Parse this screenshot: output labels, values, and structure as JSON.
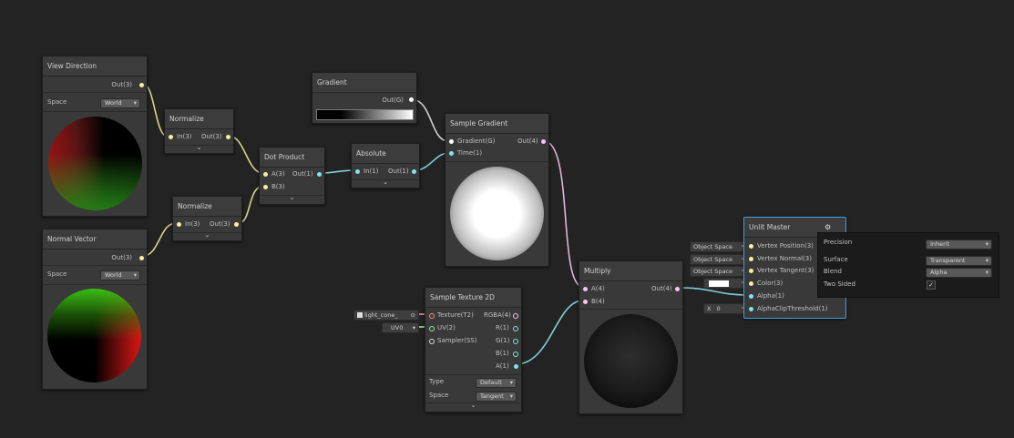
{
  "view_direction": {
    "title": "View Direction",
    "out": "Out(3)",
    "space_label": "Space",
    "space_value": "World"
  },
  "normal_vector": {
    "title": "Normal Vector",
    "out": "Out(3)",
    "space_label": "Space",
    "space_value": "World"
  },
  "normalize_1": {
    "title": "Normalize",
    "in": "In(3)",
    "out": "Out(3)"
  },
  "normalize_2": {
    "title": "Normalize",
    "in": "In(3)",
    "out": "Out(3)"
  },
  "dot_product": {
    "title": "Dot Product",
    "a": "A(3)",
    "b": "B(3)",
    "out": "Out(1)"
  },
  "gradient": {
    "title": "Gradient",
    "out": "Out(G)"
  },
  "absolute": {
    "title": "Absolute",
    "in": "In(1)",
    "out": "Out(1)"
  },
  "sample_gradient": {
    "title": "Sample Gradient",
    "gradient_in": "Gradient(G)",
    "time_in": "Time(1)",
    "out": "Out(4)"
  },
  "sample_texture": {
    "title": "Sample Texture 2D",
    "inputs": [
      "Texture(T2)",
      "UV(2)",
      "Sampler(SS)"
    ],
    "outputs": [
      "RGBA(4)",
      "R(1)",
      "G(1)",
      "B(1)",
      "A(1)"
    ],
    "type_label": "Type",
    "type_value": "Default",
    "space_label": "Space",
    "space_value": "Tangent",
    "texture_chip": "light_cone_",
    "texture_chip_btn": "⊙",
    "uv_chip": "UV0"
  },
  "multiply": {
    "title": "Multiply",
    "a": "A(4)",
    "b": "B(4)",
    "out": "Out(4)"
  },
  "unlit_master": {
    "title": "Unlit Master",
    "gear_icon": "gear-icon",
    "inputs": [
      "Vertex Position(3)",
      "Vertex Normal(3)",
      "Vertex Tangent(3)",
      "Color(3)",
      "Alpha(1)",
      "AlphaClipThreshold(1)"
    ],
    "chips": [
      "Object Space",
      "Object Space",
      "Object Space"
    ],
    "color_swatch": "#ffffff",
    "clip_label": "X",
    "clip_value": "0"
  },
  "settings_popup": {
    "precision_label": "Precision",
    "precision_value": "Inherit",
    "surface_label": "Surface",
    "surface_value": "Transparent",
    "blend_label": "Blend",
    "blend_value": "Alpha",
    "two_sided_label": "Two Sided",
    "two_sided_checked": true
  },
  "colors": {
    "background": "#232323",
    "node": "#393939",
    "vec3_port": "#f4f0a0",
    "vec1_port": "#84e4e7",
    "vec4_port": "#f3c6ec",
    "selection": "#44a0e0"
  }
}
